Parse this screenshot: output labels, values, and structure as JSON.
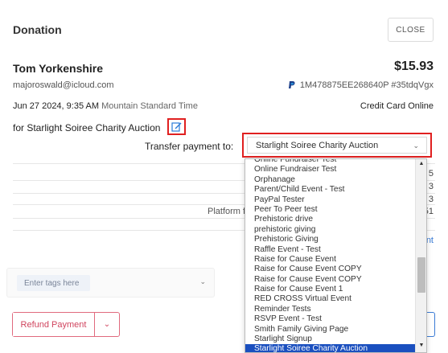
{
  "header": {
    "title": "Donation",
    "close_label": "CLOSE"
  },
  "donor": {
    "name": "Tom Yorkenshire",
    "amount": "$15.93",
    "email": "majoroswald@icloud.com",
    "transaction_id": "1M478875EE268640P #35tdqVgx",
    "date": "Jun 27 2024, 9:35 AM",
    "timezone": "Mountain Standard Time",
    "payment_method": "Credit Card Online",
    "for_line": "for Starlight Soiree Charity Auction"
  },
  "transfer": {
    "label": "Transfer payment to:",
    "selected_value": "Starlight Soiree Charity Auction"
  },
  "background": {
    "nums": [
      "5",
      "3",
      "3",
      "51"
    ],
    "platform_fee_label": "Platform f",
    "link_fragment": "nt"
  },
  "tags": {
    "placeholder": "Enter tags here"
  },
  "refund": {
    "label": "Refund Payment"
  },
  "dropdown": {
    "options": [
      "Online Fundraiser Test",
      "Online Fundraiser Test",
      "Orphanage",
      "Parent/Child Event - Test",
      "PayPal Tester",
      "Peer To Peer test",
      "Prehistoric drive",
      "prehistoric giving",
      "Prehistoric Giving",
      "Raffle Event - Test",
      "Raise for Cause Event",
      "Raise for Cause Event COPY",
      "Raise for Cause Event COPY",
      "Raise for Cause Event 1",
      "RED CROSS Virtual Event",
      "Reminder Tests",
      "RSVP Event - Test",
      "Smith Family Giving Page",
      "Starlight Signup",
      "Starlight Soiree Charity Auction"
    ],
    "selected_index": 19
  },
  "icons": {
    "edit": "edit-icon",
    "paypal": "paypal-icon",
    "chevron": "chevron-down-icon"
  },
  "colors": {
    "highlight_border": "#e02020",
    "selected_option": "#1a4fbf",
    "refund": "#d0445e",
    "link": "#3a7bd5"
  }
}
